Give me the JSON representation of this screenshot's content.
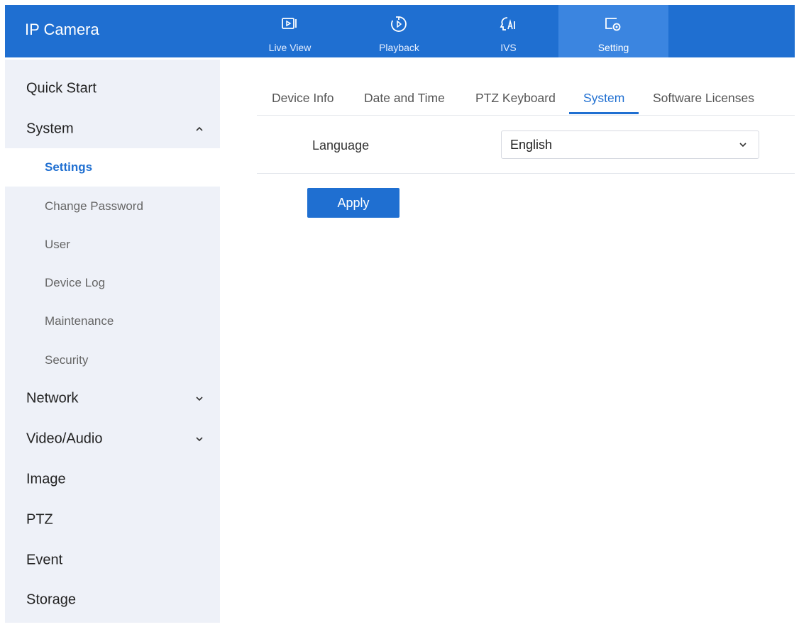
{
  "header": {
    "brand": "IP Camera",
    "tabs": [
      {
        "label": "Live View",
        "icon": "live-view-icon"
      },
      {
        "label": "Playback",
        "icon": "playback-icon"
      },
      {
        "label": "IVS",
        "icon": "ivs-ai-icon"
      },
      {
        "label": "Setting",
        "icon": "setting-icon",
        "active": true
      }
    ]
  },
  "sidebar": {
    "quick_start": "Quick Start",
    "system": "System",
    "system_children": [
      "Settings",
      "Change Password",
      "User",
      "Device Log",
      "Maintenance",
      "Security"
    ],
    "network": "Network",
    "video_audio": "Video/Audio",
    "image": "Image",
    "ptz": "PTZ",
    "event": "Event",
    "storage": "Storage"
  },
  "subtabs": [
    "Device Info",
    "Date and Time",
    "PTZ Keyboard",
    "System",
    "Software Licenses"
  ],
  "form": {
    "language_label": "Language",
    "language_value": "English",
    "apply_label": "Apply"
  },
  "colors": {
    "accent": "#1f6fd1",
    "header_active": "#3b85e0",
    "sidebar_bg": "#eef1f8"
  }
}
